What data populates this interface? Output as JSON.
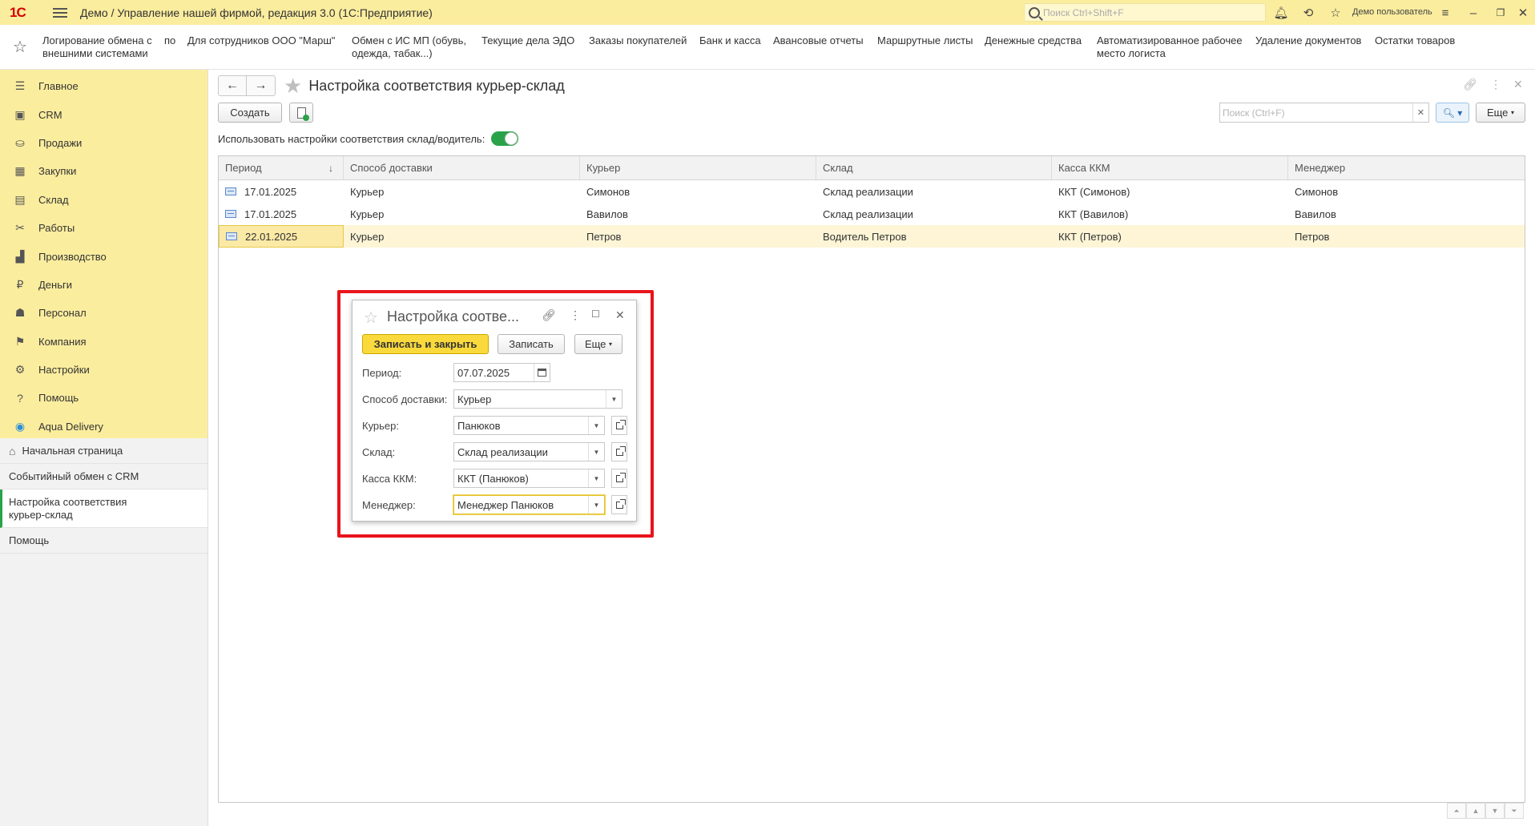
{
  "titlebar": {
    "logo": "1С",
    "title": "Демо / Управление нашей фирмой, редакция 3.0  (1С:Предприятие)",
    "search_placeholder": "Поиск Ctrl+Shift+F",
    "user": "Демо пользователь"
  },
  "navbar": {
    "links": [
      "Логирование обмена с\nвнешними системами",
      "по",
      "Для сотрудников ООО \"Марш\"",
      "Обмен с ИС МП (обувь,\nодежда, табак...)",
      "Текущие дела ЭДО",
      "Заказы покупателей",
      "Банк и касса",
      "Авансовые отчеты",
      "Маршрутные листы",
      "Денежные средства",
      "Автоматизированное рабочее\nместо логиста",
      "Удаление документов",
      "Остатки товаров"
    ]
  },
  "sidebar": {
    "sections": [
      {
        "label": "Главное",
        "icon": "menu-lines-icon"
      },
      {
        "label": "CRM",
        "icon": "crm-icon"
      },
      {
        "label": "Продажи",
        "icon": "basket-icon"
      },
      {
        "label": "Закупки",
        "icon": "purchases-icon"
      },
      {
        "label": "Склад",
        "icon": "warehouse-icon"
      },
      {
        "label": "Работы",
        "icon": "tools-icon"
      },
      {
        "label": "Производство",
        "icon": "factory-icon"
      },
      {
        "label": "Деньги",
        "icon": "ruble-icon"
      },
      {
        "label": "Персонал",
        "icon": "people-icon"
      },
      {
        "label": "Компания",
        "icon": "flag-icon"
      },
      {
        "label": "Настройки",
        "icon": "gear-icon"
      },
      {
        "label": "Помощь",
        "icon": "help-icon"
      },
      {
        "label": "Aqua Delivery",
        "icon": "location-pin-icon"
      }
    ],
    "open": {
      "home": "Начальная страница",
      "events": "Событийный обмен с CRM",
      "active": "Настройка соответствия\nкурьер-склад",
      "help": "Помощь"
    }
  },
  "form": {
    "title": "Настройка соответствия курьер-склад",
    "create": "Создать",
    "search_placeholder": "Поиск (Ctrl+F)",
    "more": "Еще",
    "toggle_label": "Использовать настройки соответствия склад/водитель:",
    "toggle_on": true,
    "columns": [
      "Период",
      "Способ доставки",
      "Курьер",
      "Склад",
      "Касса ККМ",
      "Менеджер"
    ],
    "rows": [
      {
        "period": "17.01.2025",
        "delivery": "Курьер",
        "courier": "Симонов",
        "warehouse": "Склад реализации",
        "kkm": "ККТ (Симонов)",
        "manager": "Симонов"
      },
      {
        "period": "17.01.2025",
        "delivery": "Курьер",
        "courier": "Вавилов",
        "warehouse": "Склад реализации",
        "kkm": "ККТ (Вавилов)",
        "manager": "Вавилов"
      },
      {
        "period": "22.01.2025",
        "delivery": "Курьер",
        "courier": "Петров",
        "warehouse": "Водитель Петров",
        "kkm": "ККТ (Петров)",
        "manager": "Петров"
      }
    ]
  },
  "modal": {
    "title": "Настройка соотве...",
    "save_close": "Записать и закрыть",
    "save": "Записать",
    "more": "Еще",
    "fields": {
      "period_label": "Период:",
      "period_value": "07.07.2025",
      "delivery_label": "Способ доставки:",
      "delivery_value": "Курьер",
      "courier_label": "Курьер:",
      "courier_value": "Панюков",
      "warehouse_label": "Склад:",
      "warehouse_value": "Склад реализации",
      "kkm_label": "Касса ККМ:",
      "kkm_value": "ККТ (Панюков)",
      "manager_label": "Менеджер:",
      "manager_value": "Менеджер Панюков"
    }
  },
  "colors": {
    "titlebar_bg": "#fbed9e",
    "accent_green": "#2aa24a",
    "primary_button": "#fad93c",
    "highlight_frame": "#e8141c"
  }
}
